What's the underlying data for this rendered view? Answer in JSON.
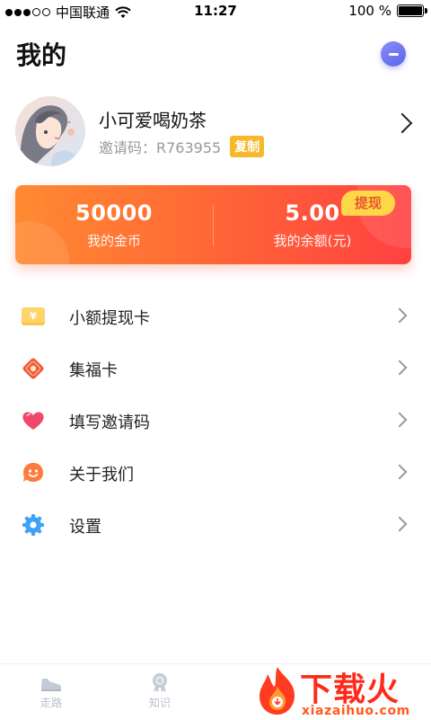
{
  "status_bar": {
    "carrier": "中国联通",
    "time": "11:27",
    "battery": "100 %",
    "battery_level": 1.0
  },
  "header": {
    "title": "我的"
  },
  "profile": {
    "nickname": "小可爱喝奶茶",
    "invite_code": "邀请码：R763955",
    "copy_label": "复制"
  },
  "wallet": {
    "coins_value": "50000",
    "coins_label": "我的金币",
    "balance_value": "5.00",
    "balance_label": "我的余额(元)",
    "withdraw_label": "提现",
    "colors": {
      "start": "#ff8a32",
      "end": "#ff4142",
      "badge": "#ffd84a"
    }
  },
  "menu": {
    "items": [
      {
        "label": "小额提现卡",
        "icon": "small-withdraw-card-icon"
      },
      {
        "label": "集福卡",
        "icon": "fortune-card-icon"
      },
      {
        "label": "填写邀请码",
        "icon": "heart-icon"
      },
      {
        "label": "关于我们",
        "icon": "smile-icon"
      },
      {
        "label": "设置",
        "icon": "gear-icon"
      }
    ]
  },
  "tabbar": {
    "items": [
      {
        "label": "走路",
        "icon": "shoe-icon"
      },
      {
        "label": "知识",
        "icon": "medal-icon"
      }
    ]
  },
  "watermark": {
    "text": "下载火",
    "subtext": "xiazaihuo.com"
  }
}
